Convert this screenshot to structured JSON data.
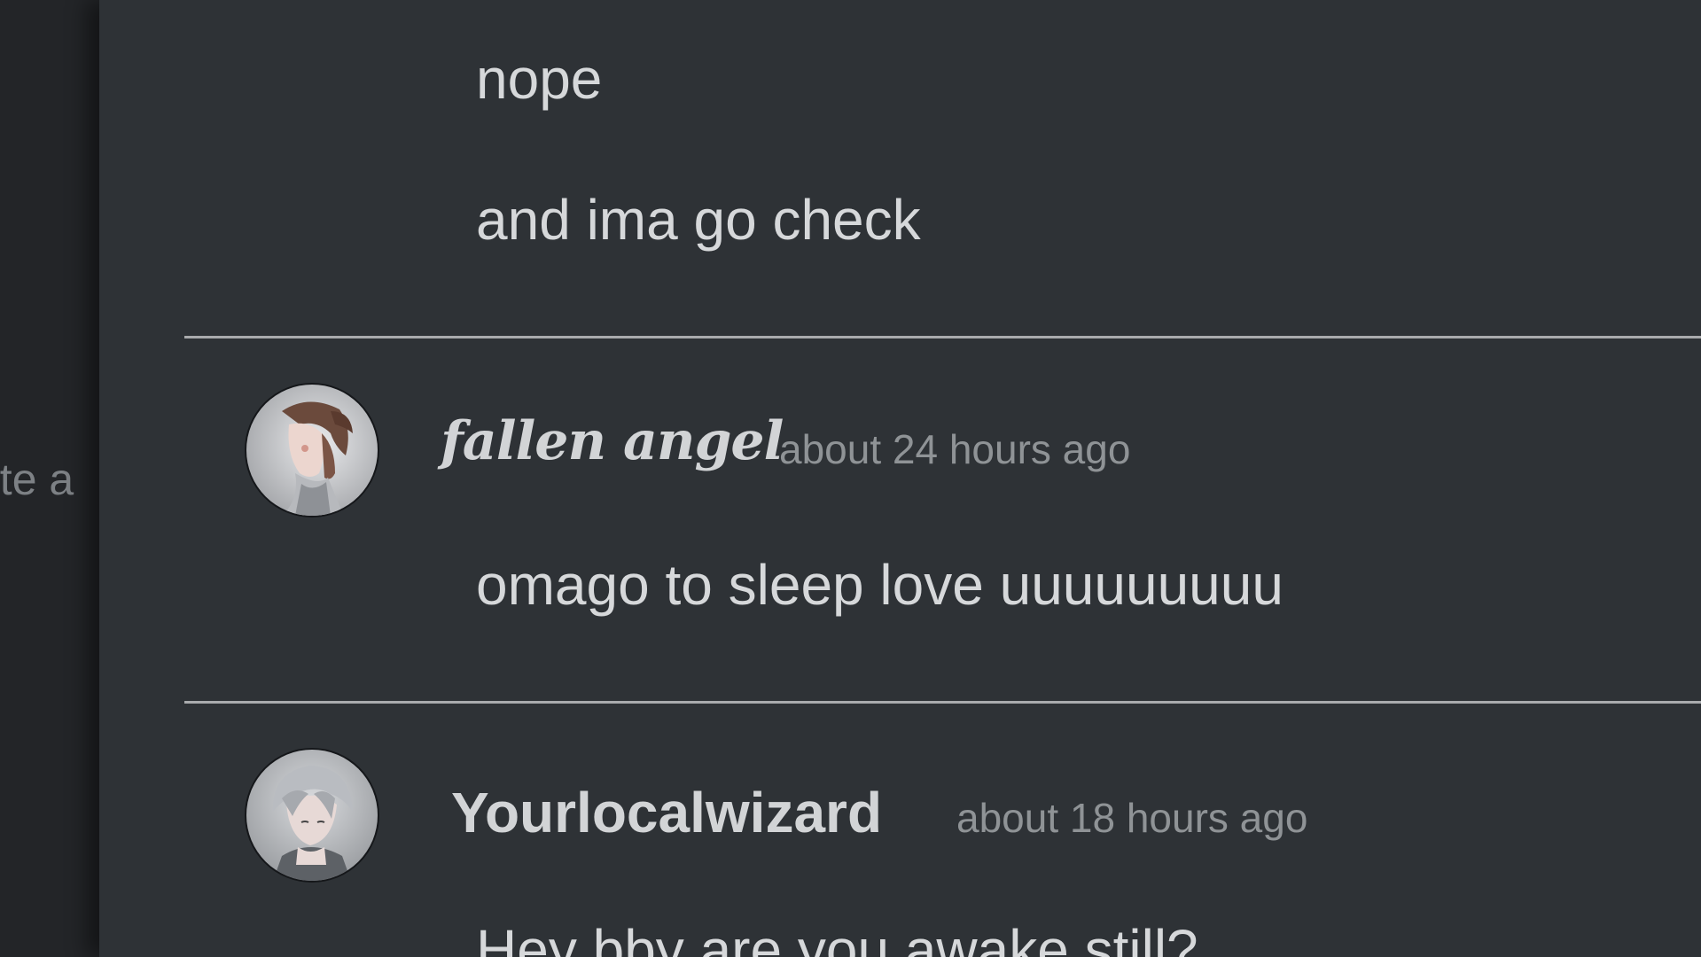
{
  "sidebar": {
    "partial_text": "ute a"
  },
  "messages": {
    "continued": [
      {
        "text": "nope"
      },
      {
        "text": "and ima go check"
      }
    ],
    "posts": [
      {
        "author": "fallen angel",
        "timestamp": "about 24 hours ago",
        "text": "omago to sleep love uuuuuuuuu",
        "avatar_icon": "anime-girl-avatar"
      },
      {
        "author": "Yourlocalwizard",
        "timestamp": "about 18 hours ago",
        "text": "Hey bby are you awake still?",
        "avatar_icon": "anime-boy-avatar"
      }
    ]
  },
  "colors": {
    "background": "#2e3236",
    "text": "#d6d8da",
    "muted": "#8f9396",
    "divider": "#a9abad"
  }
}
